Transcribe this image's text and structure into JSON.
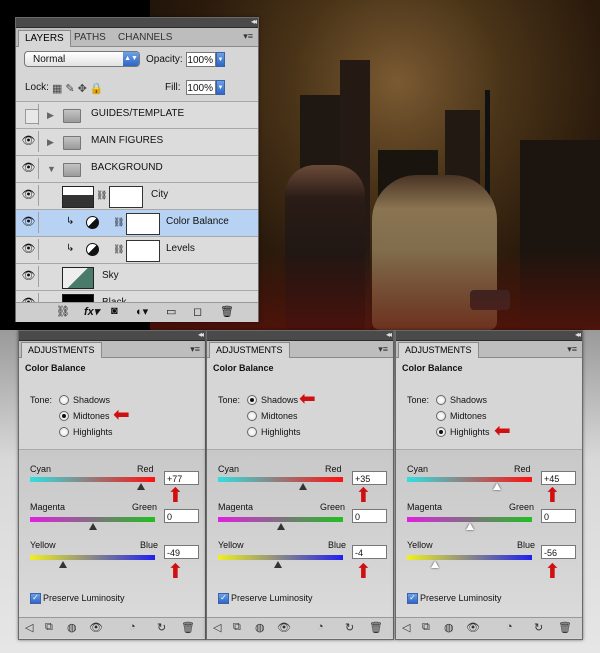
{
  "layers_panel": {
    "tabs": [
      "LAYERS",
      "PATHS",
      "CHANNELS"
    ],
    "blend_mode": "Normal",
    "opacity_label": "Opacity:",
    "opacity_value": "100%",
    "lock_label": "Lock:",
    "fill_label": "Fill:",
    "fill_value": "100%",
    "layers": [
      {
        "name": "GUIDES/TEMPLATE",
        "type": "group",
        "visible": false
      },
      {
        "name": "MAIN FIGURES",
        "type": "group",
        "visible": true
      },
      {
        "name": "BACKGROUND",
        "type": "group-open",
        "visible": true
      },
      {
        "name": "City",
        "type": "image-mask",
        "visible": true
      },
      {
        "name": "Color Balance",
        "type": "adjustment",
        "visible": true,
        "selected": true
      },
      {
        "name": "Levels",
        "type": "adjustment",
        "visible": true
      },
      {
        "name": "Sky",
        "type": "image",
        "visible": true
      },
      {
        "name": "Black",
        "type": "fill",
        "visible": true
      }
    ]
  },
  "adjustments": [
    {
      "tab": "ADJUSTMENTS",
      "title": "Color Balance",
      "tone_label": "Tone:",
      "tones": [
        "Shadows",
        "Midtones",
        "Highlights"
      ],
      "selected_tone": "Midtones",
      "sliders": [
        {
          "left": "Cyan",
          "right": "Red",
          "value": "+77",
          "fraction": 0.89
        },
        {
          "left": "Magenta",
          "right": "Green",
          "value": "0",
          "fraction": 0.5
        },
        {
          "left": "Yellow",
          "right": "Blue",
          "value": "-49",
          "fraction": 0.26
        }
      ],
      "preserve_luminosity": "Preserve Luminosity"
    },
    {
      "tab": "ADJUSTMENTS",
      "title": "Color Balance",
      "tone_label": "Tone:",
      "tones": [
        "Shadows",
        "Midtones",
        "Highlights"
      ],
      "selected_tone": "Shadows",
      "sliders": [
        {
          "left": "Cyan",
          "right": "Red",
          "value": "+35",
          "fraction": 0.68
        },
        {
          "left": "Magenta",
          "right": "Green",
          "value": "0",
          "fraction": 0.5
        },
        {
          "left": "Yellow",
          "right": "Blue",
          "value": "-4",
          "fraction": 0.48
        }
      ],
      "preserve_luminosity": "Preserve Luminosity"
    },
    {
      "tab": "ADJUSTMENTS",
      "title": "Color Balance",
      "tone_label": "Tone:",
      "tones": [
        "Shadows",
        "Midtones",
        "Highlights"
      ],
      "selected_tone": "Highlights",
      "sliders": [
        {
          "left": "Cyan",
          "right": "Red",
          "value": "+45",
          "fraction": 0.72
        },
        {
          "left": "Magenta",
          "right": "Green",
          "value": "0",
          "fraction": 0.5
        },
        {
          "left": "Yellow",
          "right": "Blue",
          "value": "-56",
          "fraction": 0.22
        }
      ],
      "preserve_luminosity": "Preserve Luminosity"
    }
  ],
  "colors": {
    "arrow": "#d01010",
    "selected_row": "#b8d2f4"
  }
}
